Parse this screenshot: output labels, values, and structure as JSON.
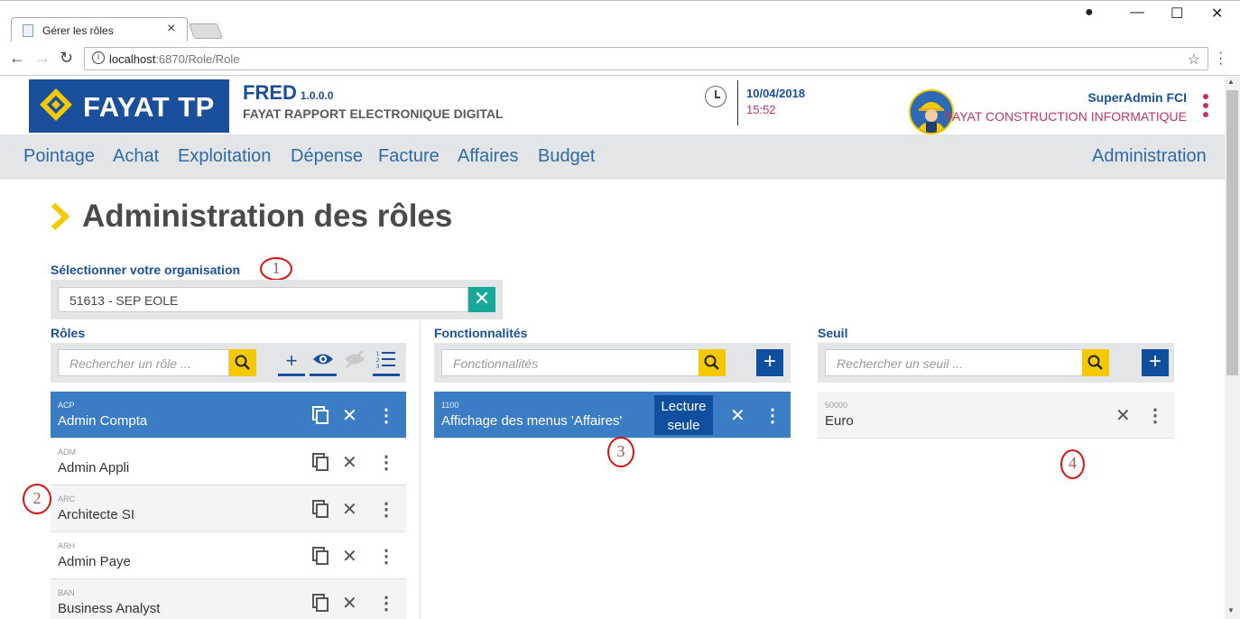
{
  "browser": {
    "tab_title": "Gérer les rôles",
    "url_host": "localhost",
    "url_rest": ":6870/Role/Role"
  },
  "header": {
    "logo_text": "FAYAT TP",
    "app_name": "FRED",
    "app_version": "1.0.0.0",
    "app_subtitle": "FAYAT RAPPORT ELECTRONIQUE DIGITAL",
    "date": "10/04/2018",
    "time": "15:52",
    "user_name": "SuperAdmin FCI",
    "user_org": "FAYAT CONSTRUCTION INFORMATIQUE"
  },
  "nav": {
    "items": [
      "Pointage",
      "Achat",
      "Exploitation",
      "Dépense",
      "Facture",
      "Affaires",
      "Budget"
    ],
    "admin": "Administration"
  },
  "page": {
    "title": "Administration des rôles",
    "org_label": "Sélectionner votre organisation",
    "org_value": "51613 - SEP EOLE"
  },
  "roles": {
    "label": "Rôles",
    "search_placeholder": "Rechercher un rôle ...",
    "items": [
      {
        "code": "ACP",
        "name": "Admin Compta"
      },
      {
        "code": "ADM",
        "name": "Admin Appli"
      },
      {
        "code": "ARC",
        "name": "Architecte SI"
      },
      {
        "code": "ARH",
        "name": "Admin Paye"
      },
      {
        "code": "BAN",
        "name": "Business Analyst"
      }
    ]
  },
  "fonctionnalites": {
    "label": "Fonctionnalités",
    "search_placeholder": "Fonctionnalités",
    "items": [
      {
        "code": "1100",
        "name": "Affichage des menus 'Affaires'",
        "mode_line1": "Lecture",
        "mode_line2": "seule"
      }
    ]
  },
  "seuil": {
    "label": "Seuil",
    "search_placeholder": "Rechercher un seuil ...",
    "items": [
      {
        "code": "50000",
        "name": "Euro"
      }
    ]
  },
  "annotations": [
    "1",
    "2",
    "3",
    "4"
  ],
  "colors": {
    "brand_blue": "#1a4f9c",
    "selected_row": "#3b7dc4",
    "accent_pink": "#c0336a",
    "search_yellow": "#f5c900",
    "clear_teal": "#16a89a"
  }
}
